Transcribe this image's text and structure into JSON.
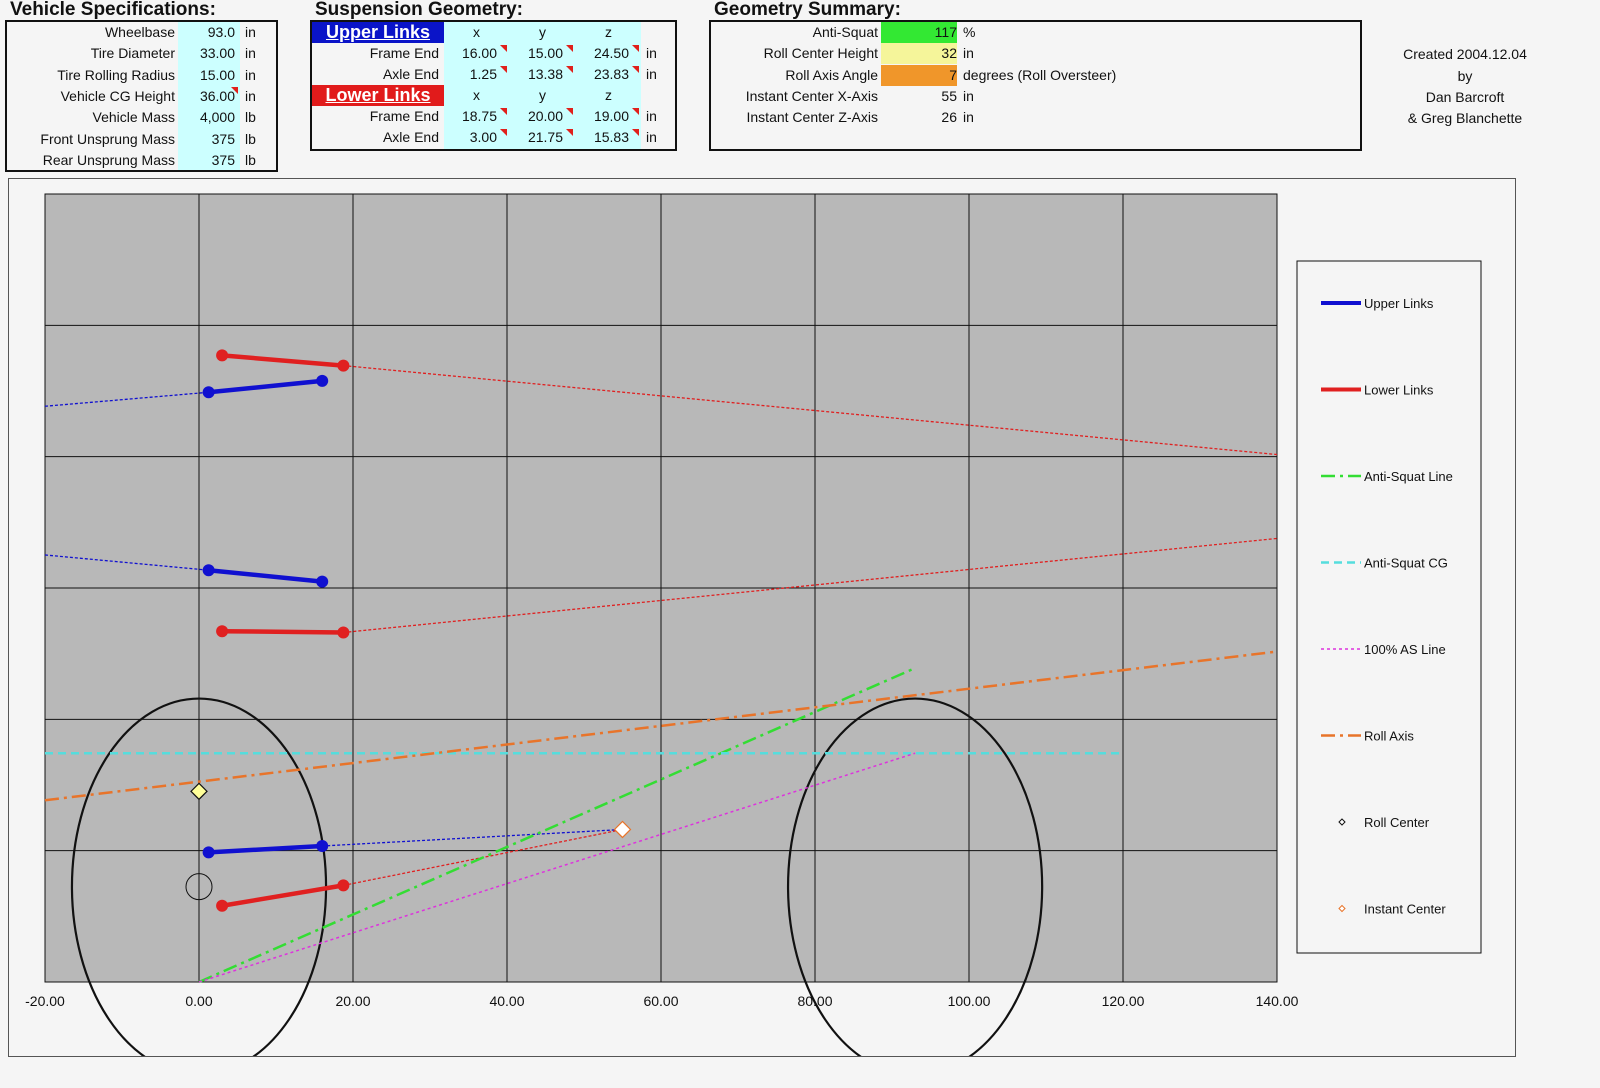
{
  "vehicle_specs": {
    "title": "Vehicle Specifications:",
    "rows": [
      {
        "label": "Wheelbase",
        "value": "93.0",
        "unit": "in"
      },
      {
        "label": "Tire Diameter",
        "value": "33.00",
        "unit": "in"
      },
      {
        "label": "Tire Rolling Radius",
        "value": "15.00",
        "unit": "in"
      },
      {
        "label": "Vehicle CG Height",
        "value": "36.00",
        "unit": "in"
      },
      {
        "label": "Vehicle Mass",
        "value": "4,000",
        "unit": "lb"
      },
      {
        "label": "Front Unsprung Mass",
        "value": "375",
        "unit": "lb"
      },
      {
        "label": "Rear Unsprung Mass",
        "value": "375",
        "unit": "lb"
      }
    ]
  },
  "suspension": {
    "title": "Suspension Geometry:",
    "upper_header": "Upper Links",
    "lower_header": "Lower Links",
    "col_x": "x",
    "col_y": "y",
    "col_z": "z",
    "upper": [
      {
        "label": "Frame End",
        "x": "16.00",
        "y": "15.00",
        "z": "24.50",
        "unit": "in"
      },
      {
        "label": "Axle End",
        "x": "1.25",
        "y": "13.38",
        "z": "23.83",
        "unit": "in"
      }
    ],
    "lower": [
      {
        "label": "Frame End",
        "x": "18.75",
        "y": "20.00",
        "z": "19.00",
        "unit": "in"
      },
      {
        "label": "Axle End",
        "x": "3.00",
        "y": "21.75",
        "z": "15.83",
        "unit": "in"
      }
    ]
  },
  "summary": {
    "title": "Geometry Summary:",
    "rows": [
      {
        "label": "Anti-Squat",
        "value": "117",
        "unit": "%",
        "color": "#33e833"
      },
      {
        "label": "Roll Center Height",
        "value": "32",
        "unit": "in",
        "color": "#f5f59a"
      },
      {
        "label": "Roll Axis Angle",
        "value": "7",
        "unit": "degrees (Roll Oversteer)",
        "color": "#f0962a"
      },
      {
        "label": "Instant Center X-Axis",
        "value": "55",
        "unit": "in",
        "color": ""
      },
      {
        "label": "Instant Center Z-Axis",
        "value": "26",
        "unit": "in",
        "color": ""
      }
    ]
  },
  "credits": {
    "line1": "Created 2004.12.04",
    "line2": "by",
    "line3": "Dan Barcroft",
    "line4": "& Greg Blanchette"
  },
  "colors": {
    "upper": "#1010d0",
    "lower": "#e02020",
    "anti_squat": "#33dd33",
    "anti_squat_cg": "#55dddd",
    "as100": "#dd33dd",
    "roll_axis": "#e8742a",
    "plot_bg": "#b8b8b8"
  },
  "chart_data": {
    "type": "scatter",
    "xlim": [
      -20,
      140
    ],
    "x_ticks": [
      "-20.00",
      "0.00",
      "20.00",
      "40.00",
      "60.00",
      "80.00",
      "100.00",
      "120.00",
      "140.00"
    ],
    "grid": true,
    "legend_position": "right",
    "series": [
      {
        "name": "Upper Links",
        "style": "solid-marker",
        "color": "#1010d0",
        "segments": [
          [
            [
              1.25,
              8.4
            ],
            [
              16,
              9.3
            ]
          ],
          [
            [
              1.25,
              -5.6
            ],
            [
              16,
              -6.5
            ]
          ],
          [
            [
              1.25,
              -27.8
            ],
            [
              16,
              -27.3
            ]
          ]
        ]
      },
      {
        "name": "Lower Links",
        "style": "solid-marker",
        "color": "#e02020",
        "segments": [
          [
            [
              3,
              11.3
            ],
            [
              18.75,
              10.5
            ]
          ],
          [
            [
              3,
              -10.4
            ],
            [
              18.75,
              -10.5
            ]
          ],
          [
            [
              3,
              -32.0
            ],
            [
              18.75,
              -30.4
            ]
          ]
        ]
      },
      {
        "name": "Anti-Squat Line",
        "style": "dashdot",
        "color": "#33dd33",
        "points": [
          [
            0,
            -38
          ],
          [
            93,
            -13.3
          ]
        ]
      },
      {
        "name": "Anti-Squat CG",
        "style": "dash",
        "color": "#55dddd",
        "points": [
          [
            -20,
            -20
          ],
          [
            120,
            -20
          ]
        ]
      },
      {
        "name": "100% AS Line",
        "style": "dot",
        "color": "#dd33dd",
        "points": [
          [
            0,
            -38
          ],
          [
            93,
            -20
          ]
        ]
      },
      {
        "name": "Roll Axis",
        "style": "dashdot",
        "color": "#e8742a",
        "points": [
          [
            -20,
            -23.7
          ],
          [
            140,
            -12
          ]
        ]
      },
      {
        "name": "Roll Center",
        "style": "marker",
        "color": "#111",
        "points": [
          [
            0,
            -23
          ]
        ]
      },
      {
        "name": "Instant Center",
        "style": "marker",
        "color": "#e8742a",
        "points": [
          [
            55,
            -26
          ]
        ]
      }
    ],
    "projections": [
      {
        "color": "#e02020",
        "points": [
          [
            18.75,
            10.5
          ],
          [
            140,
            3.5
          ]
        ]
      },
      {
        "color": "#1010d0",
        "points": [
          [
            -20,
            7.3
          ],
          [
            1.25,
            8.4
          ]
        ]
      },
      {
        "color": "#1010d0",
        "points": [
          [
            -20,
            -4.4
          ],
          [
            1.25,
            -5.6
          ]
        ]
      },
      {
        "color": "#e02020",
        "points": [
          [
            18.75,
            -10.5
          ],
          [
            140,
            -3.1
          ]
        ]
      },
      {
        "color": "#1010d0",
        "points": [
          [
            16,
            -27.3
          ],
          [
            55,
            -26
          ]
        ]
      },
      {
        "color": "#e02020",
        "points": [
          [
            18.75,
            -30.4
          ],
          [
            55,
            -26
          ]
        ]
      }
    ],
    "tires": [
      [
        0,
        -30.5
      ],
      [
        93,
        -30.5
      ]
    ],
    "axle_center": [
      0,
      -30.5
    ]
  }
}
